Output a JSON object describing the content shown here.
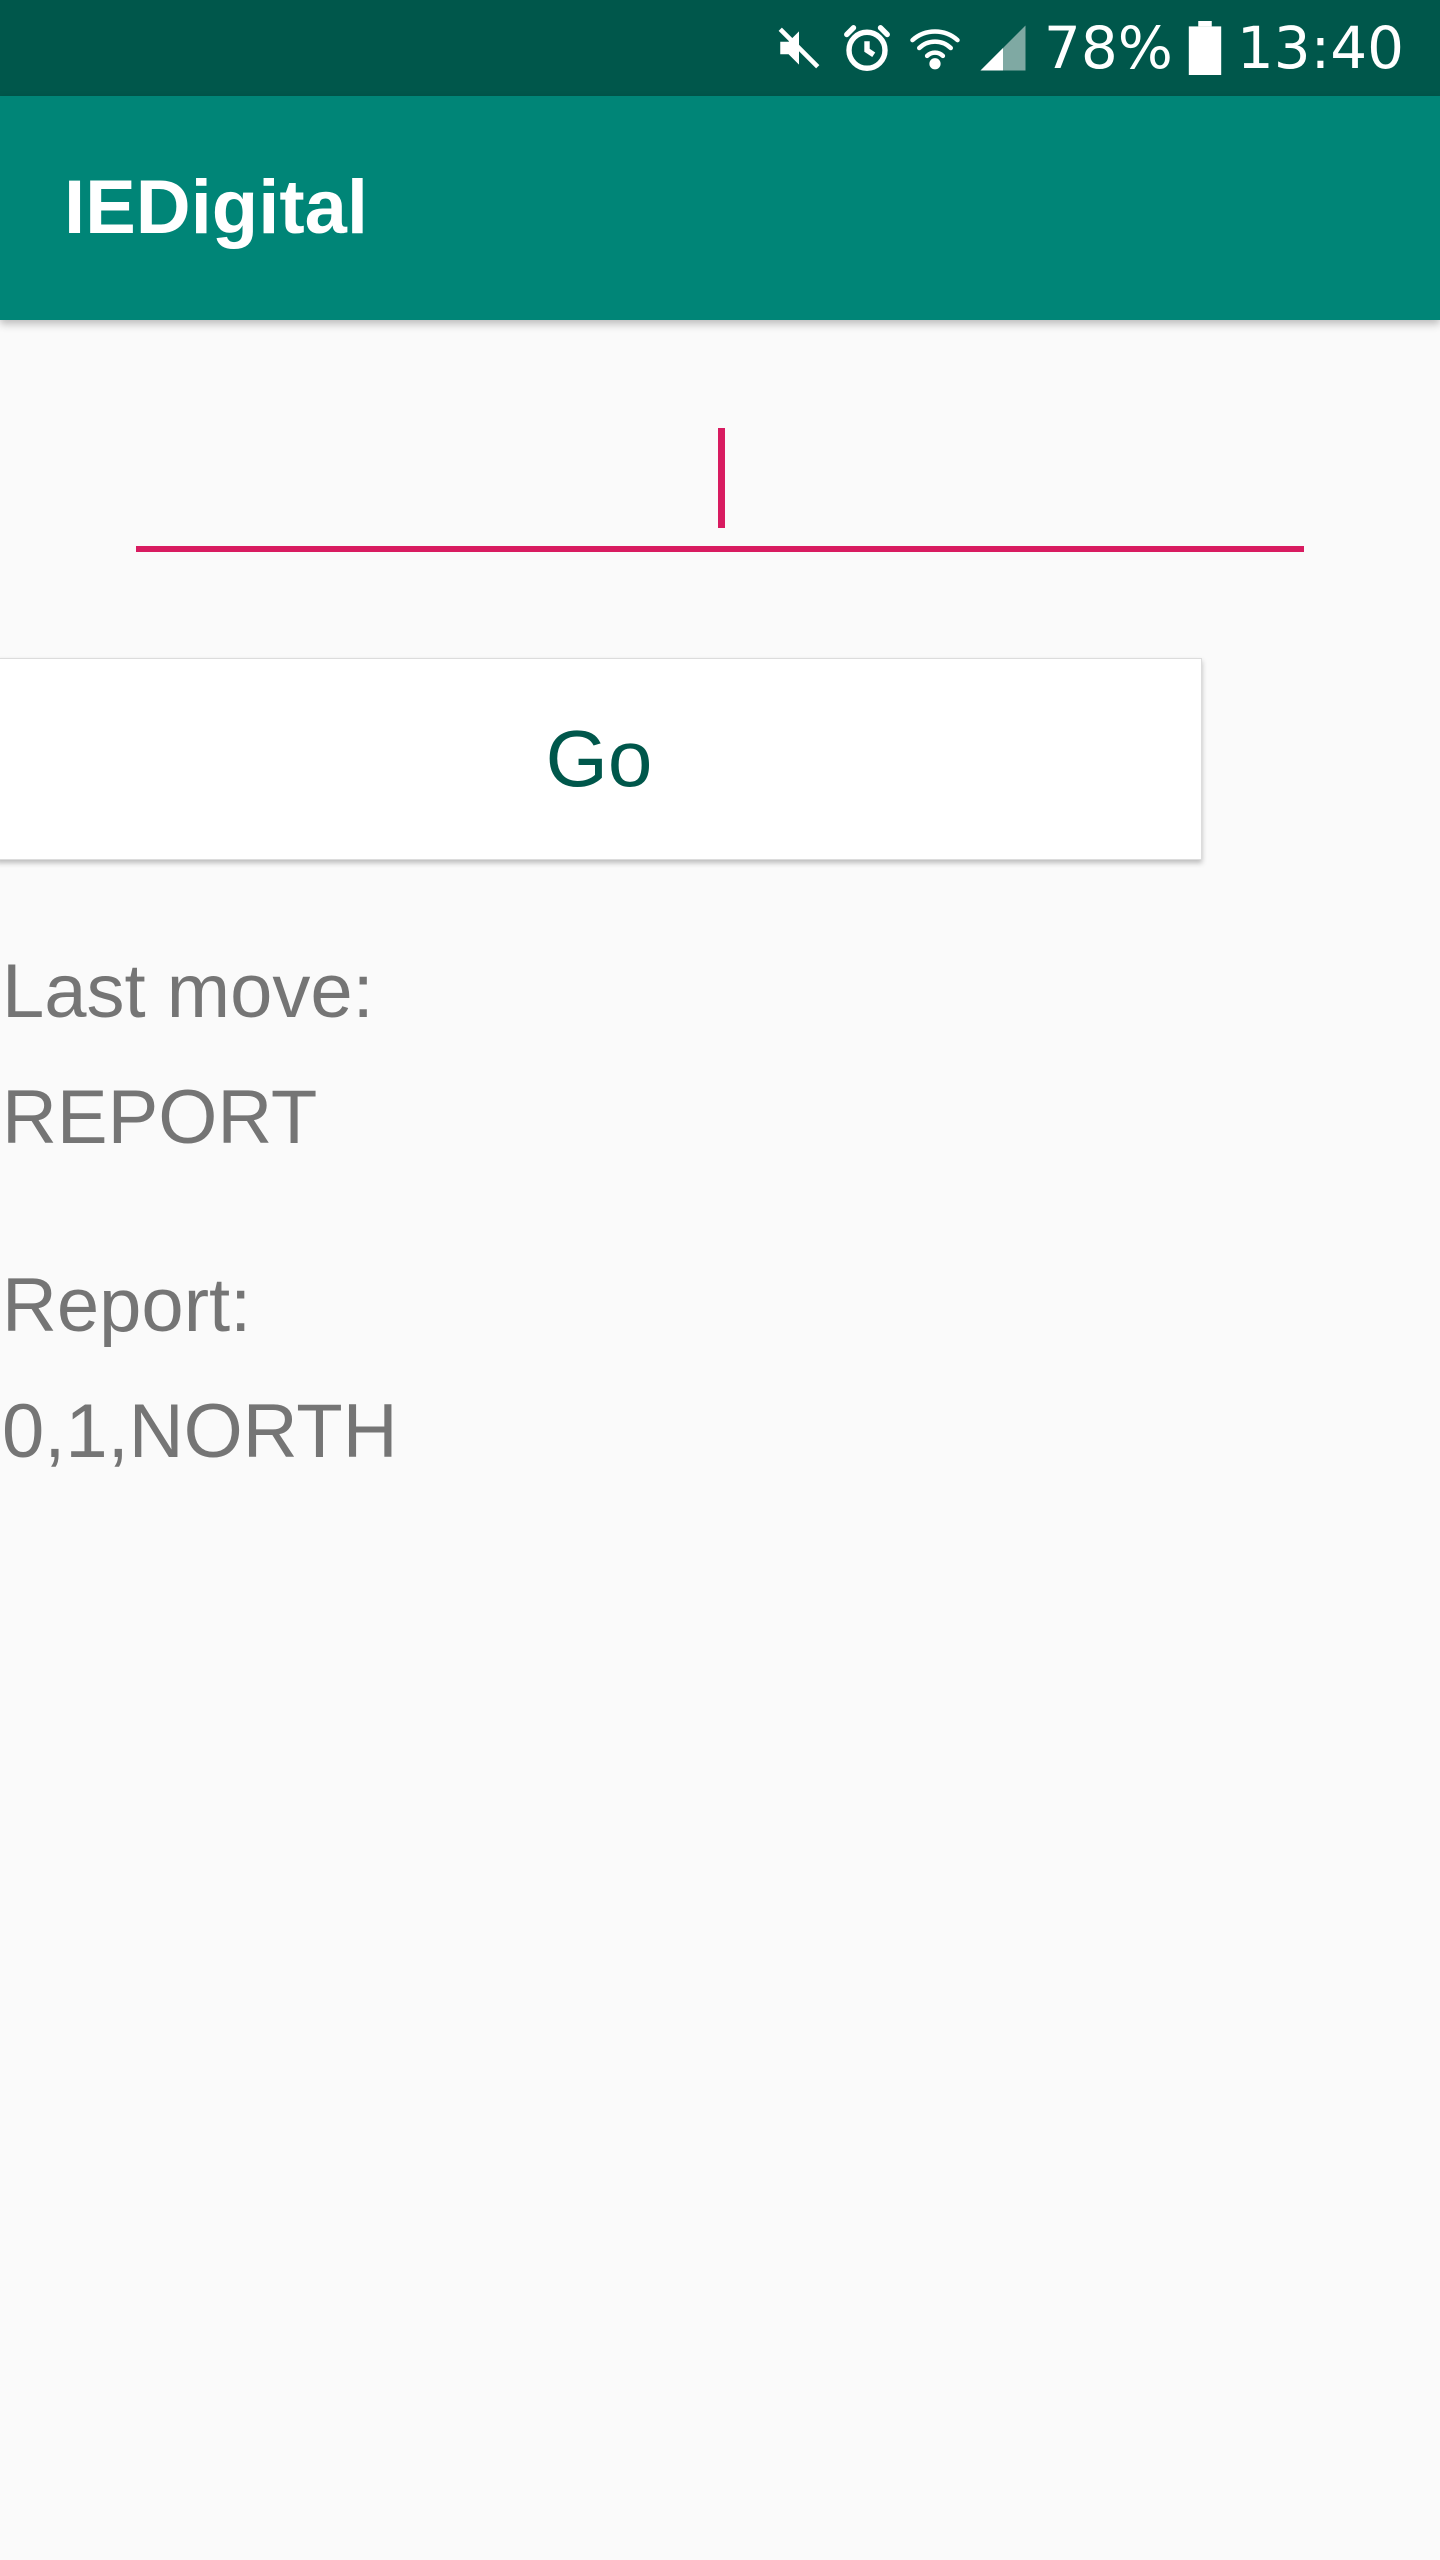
{
  "status_bar": {
    "icons": [
      "mute-icon",
      "alarm-icon",
      "wifi-icon",
      "signal-icon",
      "battery-icon"
    ],
    "battery_percent": "78%",
    "time": "13:40",
    "background": "#00574b"
  },
  "app_bar": {
    "title": "IEDigital",
    "background": "#008577"
  },
  "command_input": {
    "value": "",
    "placeholder": "",
    "accent": "#d81b60"
  },
  "go_button": {
    "label": "Go"
  },
  "last_move": {
    "label": "Last move:",
    "value": "REPORT"
  },
  "report": {
    "label": "Report:",
    "value": "0,1,NORTH"
  }
}
